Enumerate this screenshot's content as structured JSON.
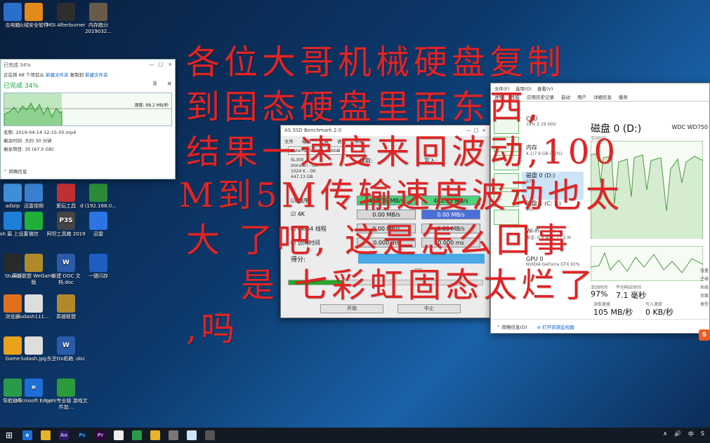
{
  "desktop_icons": [
    {
      "label": "击电脑",
      "color": "#2a6fc9",
      "glyph": ""
    },
    {
      "label": "火绒安全软件",
      "color": "#e28a1c",
      "glyph": ""
    },
    {
      "label": "MSI Afterburner",
      "color": "#2e2e2e",
      "glyph": ""
    },
    {
      "label": "内存跑分 2019032...",
      "color": "#6a5a4a",
      "glyph": ""
    },
    {
      "label": "",
      "color": "#4a7bb5",
      "glyph": ""
    },
    {
      "label": "",
      "color": "#3b6fb0",
      "glyph": ""
    },
    {
      "label": "",
      "color": "#1a1a1a",
      "glyph": ""
    },
    {
      "label": "",
      "color": "#c33",
      "glyph": ""
    },
    {
      "label": "adizip",
      "color": "#3f8fd8",
      "glyph": ""
    },
    {
      "label": "迅雷视频",
      "color": "#3a7fd0",
      "glyph": ""
    },
    {
      "label": "爱玩工具",
      "color": "#c03030",
      "glyph": ""
    },
    {
      "label": "d (192.168.0...",
      "color": "#2a8a3a",
      "glyph": ""
    },
    {
      "label": "esh 篇 上设置",
      "color": "#1d7fd6",
      "glyph": ""
    },
    {
      "label": "微信",
      "color": "#20b039",
      "glyph": ""
    },
    {
      "label": "阿坦工具箱 2019",
      "color": "#444",
      "glyph": "P3S"
    },
    {
      "label": "迅雷",
      "color": "#2b74e2",
      "glyph": ""
    },
    {
      "label": "Studio",
      "color": "#2a2a2a",
      "glyph": ""
    },
    {
      "label": "英雄联盟 WeGame版",
      "color": "#b08a2a",
      "glyph": ""
    },
    {
      "label": "新建 DOC 文 档.doc",
      "color": "#2a5aa8",
      "glyph": "W"
    },
    {
      "label": "一键闪存",
      "color": "#1d5fc0",
      "glyph": ""
    },
    {
      "label": "浏览器",
      "color": "#e0701c",
      "glyph": ""
    },
    {
      "label": "ludash111...",
      "color": "#ddd",
      "glyph": ""
    },
    {
      "label": "英雄联盟",
      "color": "#b08a2a",
      "glyph": ""
    },
    {
      "label": "Game",
      "color": "#e8a21c",
      "glyph": ""
    },
    {
      "label": "ludash.jpg",
      "color": "#ddd",
      "glyph": ""
    },
    {
      "label": "东芝ttx机箱 .doc",
      "color": "#2a5aa8",
      "glyph": "W"
    },
    {
      "label": "导航助手",
      "color": "#2a9a4a",
      "glyph": ""
    },
    {
      "label": "Microsoft Edge",
      "color": "#1d6fd6",
      "glyph": "e"
    },
    {
      "label": "Inphi专业级 游戏文件加...",
      "color": "#2a9a3a",
      "glyph": ""
    }
  ],
  "copy_dialog": {
    "title": "已完成 34%",
    "line1_prefix": "正在将 68 个项目从",
    "line1_src": "新建文件夹",
    "line1_mid": "复制到",
    "line1_dst": "新建文件夹",
    "percent": "已完成 34%",
    "speed": "速度: 98.2 MB/秒",
    "name": "名称: 2019-04-14 12-15-05.mp4",
    "remaining_time": "剩余时间: 大约 30 分钟",
    "remaining_items": "剩余项目: 35 (67.0 GB)",
    "less": "简略信息",
    "pause": "II",
    "close": "×",
    "minimize": "—",
    "max": "□",
    "win_close": "×"
  },
  "benchmark": {
    "title": "AS SSD Benchmark 2.0",
    "menus": [
      "文件",
      "编辑",
      "工具",
      "语言",
      "帮助"
    ],
    "drive": "Colorful SL300 480GB",
    "drive_lines": [
      "SL300 ...",
      "storahci - OK",
      "1024 K - OK",
      "447.13 GB"
    ],
    "read_hdr": "读取:",
    "write_hdr": "写入:",
    "rows": [
      {
        "label": "顺序",
        "read": "498.19 MB/s",
        "write": "461.41 MB/s",
        "read_style": "green",
        "write_style": "green"
      },
      {
        "label": "4K",
        "read": "0.00 MB/s",
        "write": "0.00 MB/s",
        "read_style": "gray",
        "write_style": "blue"
      },
      {
        "label": "4K-64 线程",
        "read": "0.00 MB/s",
        "write": "0.00 MB/s",
        "read_style": "gray",
        "write_style": "gray"
      },
      {
        "label": "访问时间",
        "read": "0.000 ms",
        "write": "0.000 ms",
        "read_style": "gray",
        "write_style": "gray"
      }
    ],
    "score_label": "得分:",
    "score_dash": "----",
    "progress": 0.28,
    "start": "开始",
    "stop": "中止"
  },
  "taskmgr": {
    "menus": [
      "文件(F)",
      "选项(O)",
      "查看(V)"
    ],
    "tabs": [
      "进程",
      "性能",
      "应用历史记录",
      "启动",
      "用户",
      "详细信息",
      "服务"
    ],
    "items": [
      {
        "title": "CPU",
        "sub": "19% 2.19 GHz"
      },
      {
        "title": "内存",
        "sub": "4.1/7.9 GB (52%)"
      },
      {
        "title": "磁盘 0 (D:)",
        "sub": "97%"
      },
      {
        "title": "磁盘 1 (C: F:)",
        "sub": "0%"
      },
      {
        "title": "Wi-Fi",
        "sub": "发送: 0.9 接收: 11.2 M"
      },
      {
        "title": "GPU 0",
        "sub": "NVIDIA GeForce GTX 91%"
      }
    ],
    "main_title": "磁盘 0 (D:)",
    "model": "WDC WD750",
    "activity_label": "活动时间",
    "active_time_label": "活动时间",
    "active_time": "97%",
    "response_label": "平均响应时间",
    "response": "7.1 毫秒",
    "read_label": "读取速度",
    "read_speed": "105 MB/秒",
    "write_label": "写入速度",
    "write_speed": "0 KB/秒",
    "side_labels": [
      "容量",
      "已格",
      "系统",
      "页面",
      "类型"
    ],
    "footer_less": "简略信息(D)",
    "footer_link": "打开资源监视器"
  },
  "overlay": {
    "line1": "各位大哥机械硬盘复制",
    "line2": "到固态硬盘里面东西,",
    "line3": "结果一速度来回波动,100",
    "line4": "M到5M传输速度波动也太",
    "line5": "大 了吧, 这是怎么回事",
    "line6": "是 七彩虹固态太烂了",
    "line7": ",吗"
  },
  "taskbar": {
    "apps": [
      "start",
      "search",
      "explorer",
      "ae",
      "ps",
      "pr",
      "app5",
      "app6",
      "app7",
      "app8",
      "app9",
      "app10"
    ],
    "tray": [
      "∧",
      "🔊",
      "中",
      "S"
    ]
  },
  "colors": {
    "overlay": "#e02424",
    "accent": "#0b63c7",
    "bench_green": "#4cd37c",
    "bench_blue": "#4c6fd6"
  }
}
